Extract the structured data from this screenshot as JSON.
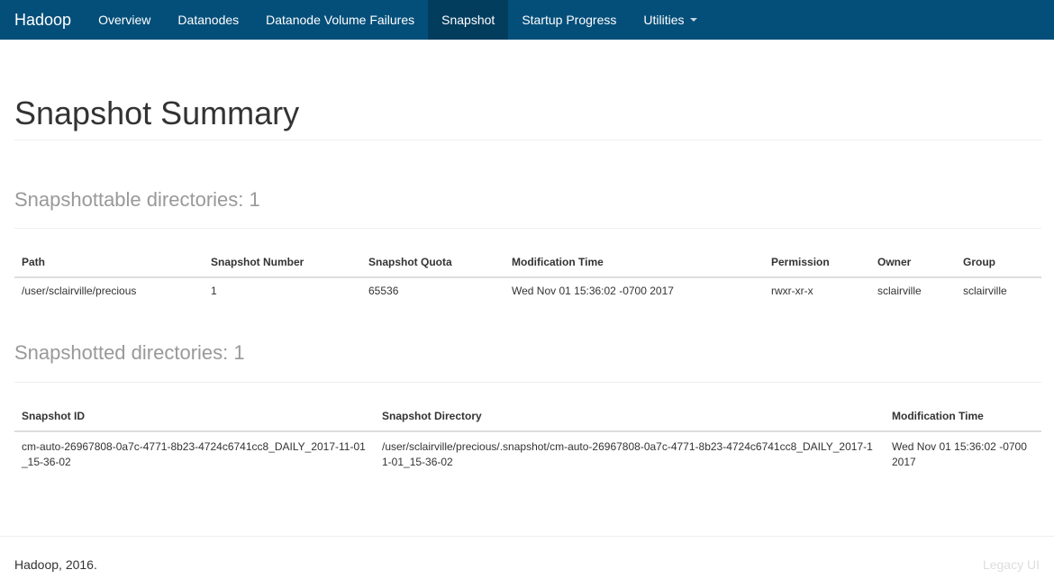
{
  "navbar": {
    "brand": "Hadoop",
    "items": [
      {
        "label": "Overview"
      },
      {
        "label": "Datanodes"
      },
      {
        "label": "Datanode Volume Failures"
      },
      {
        "label": "Snapshot"
      },
      {
        "label": "Startup Progress"
      },
      {
        "label": "Utilities"
      }
    ]
  },
  "page_title": "Snapshot Summary",
  "snapshottable": {
    "heading": "Snapshottable directories: 1",
    "columns": [
      "Path",
      "Snapshot Number",
      "Snapshot Quota",
      "Modification Time",
      "Permission",
      "Owner",
      "Group"
    ],
    "rows": [
      [
        "/user/sclairville/precious",
        "1",
        "65536",
        "Wed Nov 01 15:36:02 -0700 2017",
        "rwxr-xr-x",
        "sclairville",
        "sclairville"
      ]
    ]
  },
  "snapshotted": {
    "heading": "Snapshotted directories: 1",
    "columns": [
      "Snapshot ID",
      "Snapshot Directory",
      "Modification Time"
    ],
    "rows": [
      [
        "cm-auto-26967808-0a7c-4771-8b23-4724c6741cc8_DAILY_2017-11-01_15-36-02",
        "/user/sclairville/precious/.snapshot/cm-auto-26967808-0a7c-4771-8b23-4724c6741cc8_DAILY_2017-11-01_15-36-02",
        "Wed Nov 01 15:36:02 -0700 2017"
      ]
    ]
  },
  "footer": {
    "copyright": "Hadoop, 2016.",
    "legacy_link": "Legacy UI"
  },
  "colors": {
    "navbar_bg": "#044f7a",
    "navbar_active_bg": "#033d5e",
    "heading_gray": "#999999"
  }
}
